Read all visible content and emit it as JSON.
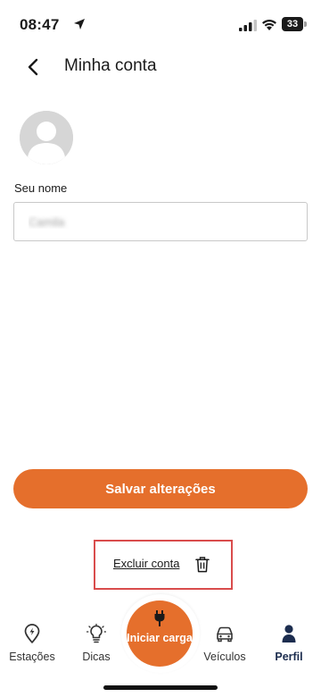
{
  "status_bar": {
    "time": "08:47",
    "battery": "33"
  },
  "header": {
    "title": "Minha conta"
  },
  "form": {
    "name_label": "Seu nome",
    "name_value": "Camila"
  },
  "actions": {
    "save_label": "Salvar alterações",
    "delete_label": "Excluir conta"
  },
  "tabbar": {
    "tabs": [
      {
        "label": "Estações",
        "icon": "ev-station-pin-icon"
      },
      {
        "label": "Dicas",
        "icon": "lightbulb-icon"
      },
      {
        "label": "Veículos",
        "icon": "car-icon"
      },
      {
        "label": "Perfil",
        "icon": "person-icon",
        "active": true
      }
    ],
    "center_button": {
      "label": "Iniciar carga",
      "icon": "plug-icon"
    }
  },
  "colors": {
    "accent": "#e56f2c",
    "highlight_border": "#d94c4c",
    "active_tab": "#1c2d4f"
  }
}
